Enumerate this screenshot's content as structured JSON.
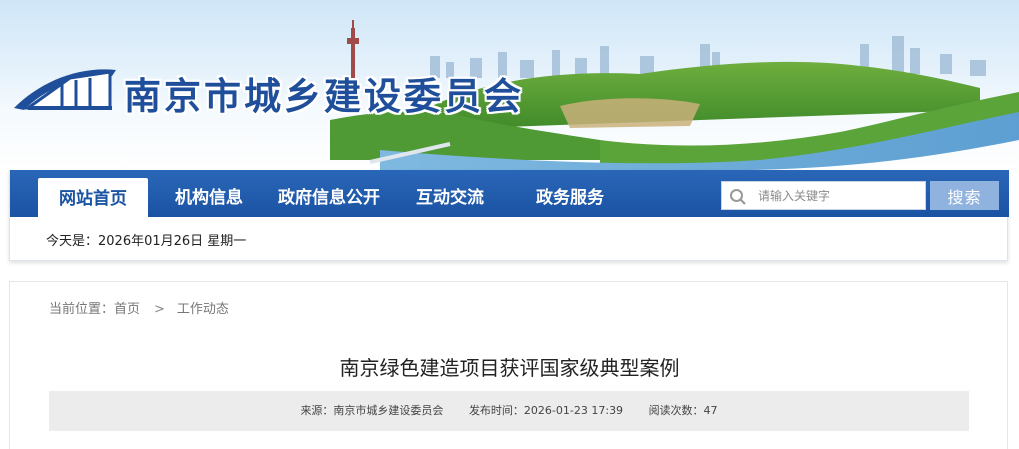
{
  "site": {
    "title": "南京市城乡建设委员会"
  },
  "nav": {
    "items": [
      {
        "label": "网站首页",
        "active": true
      },
      {
        "label": "机构信息",
        "active": false
      },
      {
        "label": "政府信息公开",
        "active": false
      },
      {
        "label": "互动交流",
        "active": false
      },
      {
        "label": "政务服务",
        "active": false
      }
    ]
  },
  "search": {
    "placeholder": "请输入关键字",
    "button_label": "搜索"
  },
  "date_line": "今天是：2026年01月26日  星期一",
  "breadcrumb": {
    "prefix": "当前位置：首页",
    "separator": ">",
    "current": "工作动态"
  },
  "article": {
    "title": "南京绿色建造项目获评国家级典型案例",
    "source": "来源：南京市城乡建设委员会",
    "published": "发布时间：2026-01-23 17:39",
    "views": "阅读次数：47"
  },
  "colors": {
    "nav_blue": "#1b53a3",
    "title_blue": "#1f4f9a",
    "search_button": "#8fb3de"
  }
}
